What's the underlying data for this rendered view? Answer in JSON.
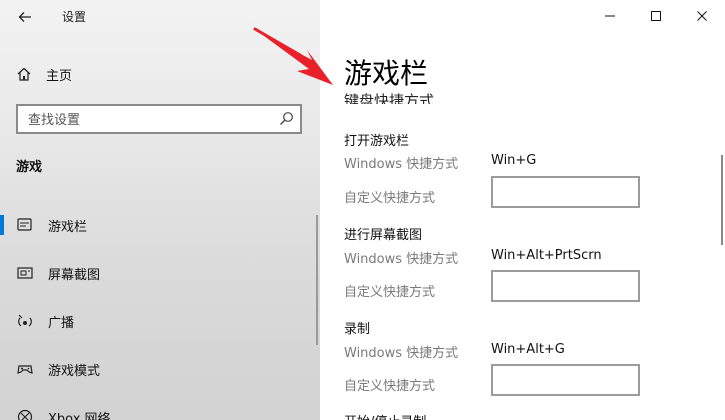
{
  "window": {
    "title": "设置",
    "controls": {
      "minimize": "—",
      "maximize": "☐",
      "close": "✕"
    }
  },
  "nav": {
    "home_label": "主页",
    "search_placeholder": "查找设置",
    "section_title": "游戏",
    "items": [
      {
        "label": "游戏栏",
        "icon": "gamebar-icon",
        "selected": true
      },
      {
        "label": "屏幕截图",
        "icon": "capture-icon",
        "selected": false
      },
      {
        "label": "广播",
        "icon": "broadcast-icon",
        "selected": false
      },
      {
        "label": "游戏模式",
        "icon": "game-mode-icon",
        "selected": false
      },
      {
        "label": "Xbox 网络",
        "icon": "xbox-network-icon",
        "selected": false
      }
    ]
  },
  "content": {
    "page_title": "游戏栏",
    "partial_heading": "键盘快捷方式",
    "groups": [
      {
        "title": "打开游戏栏",
        "windows_label": "Windows 快捷方式",
        "windows_value": "Win+G",
        "custom_label": "自定义快捷方式",
        "custom_value": ""
      },
      {
        "title": "进行屏幕截图",
        "windows_label": "Windows 快捷方式",
        "windows_value": "Win+Alt+PrtScrn",
        "custom_label": "自定义快捷方式",
        "custom_value": ""
      },
      {
        "title": "录制",
        "windows_label": "Windows 快捷方式",
        "windows_value": "Win+Alt+G",
        "custom_label": "自定义快捷方式",
        "custom_value": ""
      }
    ],
    "partial_next_group": "开始/停止录制"
  },
  "colors": {
    "accent": "#0078d7",
    "annotation_arrow": "#e8202a"
  }
}
